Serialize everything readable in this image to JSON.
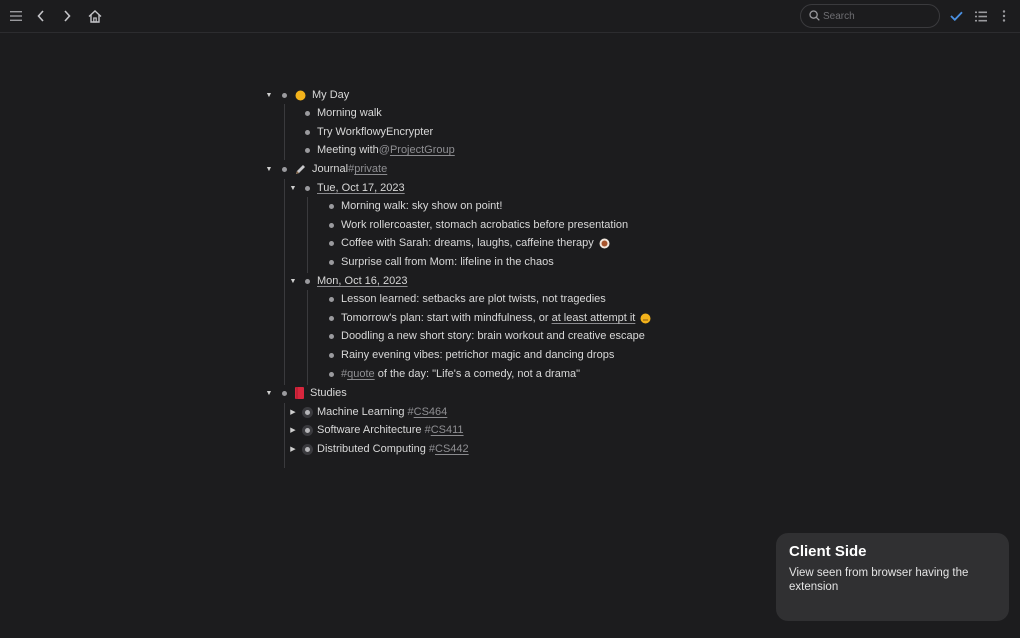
{
  "search": {
    "placeholder": "Search"
  },
  "outline": {
    "my_day": {
      "title": "My Day",
      "items": [
        "Morning walk",
        "Try WorkflowyEncrypter"
      ],
      "meeting_prefix": "Meeting with ",
      "meeting_mention_at": "@",
      "meeting_mention": "ProjectGroup"
    },
    "journal": {
      "title": "Journal ",
      "tag_hash": "#",
      "tag": "private",
      "days": [
        {
          "date": "Tue, Oct 17, 2023",
          "entries": [
            "Morning walk: sky show on point!",
            "Work rollercoaster, stomach acrobatics before presentation",
            "Coffee with Sarah: dreams, laughs, caffeine therapy",
            "Surprise call from Mom: lifeline in the chaos"
          ]
        },
        {
          "date": "Mon, Oct 16, 2023",
          "entries": [
            "Lesson learned: setbacks are plot twists, not tragedies",
            "Tomorrow's plan: start with mindfulness, or ",
            "Doodling a new short story: brain workout and creative escape",
            "Rainy evening vibes: petrichor magic and dancing drops"
          ],
          "plan_link": "at least attempt it",
          "quote_hash": "#",
          "quote_tag": "quote",
          "quote_text": " of the day: \"Life's a comedy, not a drama\""
        }
      ]
    },
    "studies": {
      "title": "Studies",
      "courses": [
        {
          "name": "Machine Learning ",
          "hash": "#",
          "code": "CS464"
        },
        {
          "name": "Software Architecture ",
          "hash": "#",
          "code": "CS411"
        },
        {
          "name": "Distributed Computing ",
          "hash": "#",
          "code": "CS442"
        }
      ]
    }
  },
  "toast": {
    "title": "Client Side",
    "body": "View seen from browser having the extension"
  },
  "colors": {
    "background": "#1c1c1e",
    "accent_check": "#4a90e2",
    "toast_bg": "#303032"
  },
  "icons": [
    "menu-icon",
    "back-icon",
    "forward-icon",
    "home-icon",
    "search-icon",
    "check-icon",
    "list-icon",
    "more-icon",
    "sun-icon",
    "pen-icon",
    "book-icon",
    "coffee-icon",
    "smile-icon"
  ]
}
